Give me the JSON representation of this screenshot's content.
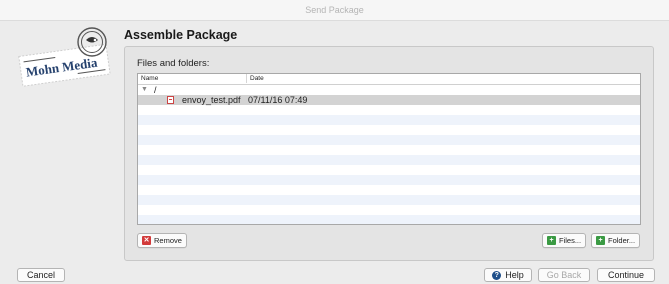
{
  "window": {
    "title": "Send Package"
  },
  "logo": {
    "text": "Mohn Media"
  },
  "page": {
    "heading": "Assemble Package"
  },
  "panel": {
    "section_label": "Files and folders:",
    "columns": [
      "Name",
      "Date"
    ],
    "root": {
      "label": "/",
      "expanded": true
    },
    "files": [
      {
        "name": "envoy_test.pdf",
        "date": "07/11/16 07:49",
        "icon": "pdf-file-icon",
        "selected": true
      }
    ],
    "remove_label": "Remove",
    "files_button_label": "Files...",
    "folder_button_label": "Folder..."
  },
  "footer": {
    "cancel_label": "Cancel",
    "help_label": "Help",
    "back_label": "Go Back",
    "continue_label": "Continue"
  }
}
